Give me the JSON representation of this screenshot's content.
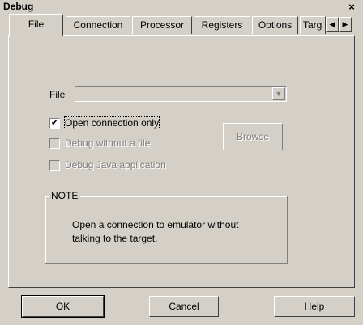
{
  "window": {
    "title": "Debug",
    "close_icon": "×"
  },
  "tabs": [
    {
      "label": "File"
    },
    {
      "label": "Connection"
    },
    {
      "label": "Processor"
    },
    {
      "label": "Registers"
    },
    {
      "label": "Options"
    },
    {
      "label": "Targ"
    }
  ],
  "tab_scroll": {
    "left": "◀",
    "right": "▶"
  },
  "file": {
    "label": "File",
    "value": "",
    "dropdown_icon": "▼"
  },
  "options": [
    {
      "label": "Open connection only",
      "checked": true,
      "enabled": true,
      "mark": "✔"
    },
    {
      "label": "Debug without a file",
      "checked": false,
      "enabled": false,
      "mark": ""
    },
    {
      "label": "Debug Java application",
      "checked": false,
      "enabled": false,
      "mark": ""
    }
  ],
  "browse_label": "Browse",
  "note": {
    "title": "NOTE",
    "text": "Open a connection to emulator without talking to the target."
  },
  "buttons": {
    "ok": "OK",
    "cancel": "Cancel",
    "help": "Help"
  },
  "colors": {
    "face": "#d4d0c8",
    "shadow": "#808080",
    "highlight": "#ffffff"
  }
}
